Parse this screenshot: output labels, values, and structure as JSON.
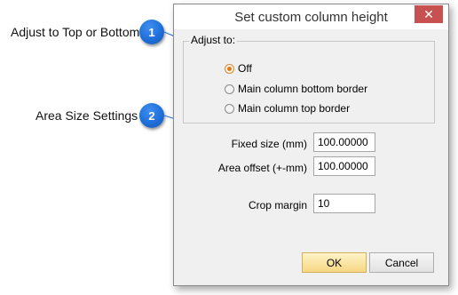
{
  "callouts": [
    {
      "number": "1",
      "text": "Adjust to Top or Bottom"
    },
    {
      "number": "2",
      "text": "Area Size Settings"
    }
  ],
  "dialog": {
    "title": "Set custom column height",
    "close_icon": "close-icon",
    "adjust_group": {
      "label": "Adjust to:",
      "options": [
        {
          "label": "Off",
          "checked": true
        },
        {
          "label": "Main column bottom border",
          "checked": false
        },
        {
          "label": "Main column top border",
          "checked": false
        }
      ]
    },
    "fixed_size": {
      "label": "Fixed size (mm)",
      "value": "100.00000"
    },
    "area_offset": {
      "label": "Area offset (+-mm)",
      "value": "100.00000"
    },
    "crop_margin": {
      "label": "Crop margin",
      "value": "10"
    },
    "ok_label": "OK",
    "cancel_label": "Cancel"
  },
  "colors": {
    "accent_close": "#c75050",
    "badge": "#1e6fd9",
    "ok_button": "#f6d783"
  }
}
